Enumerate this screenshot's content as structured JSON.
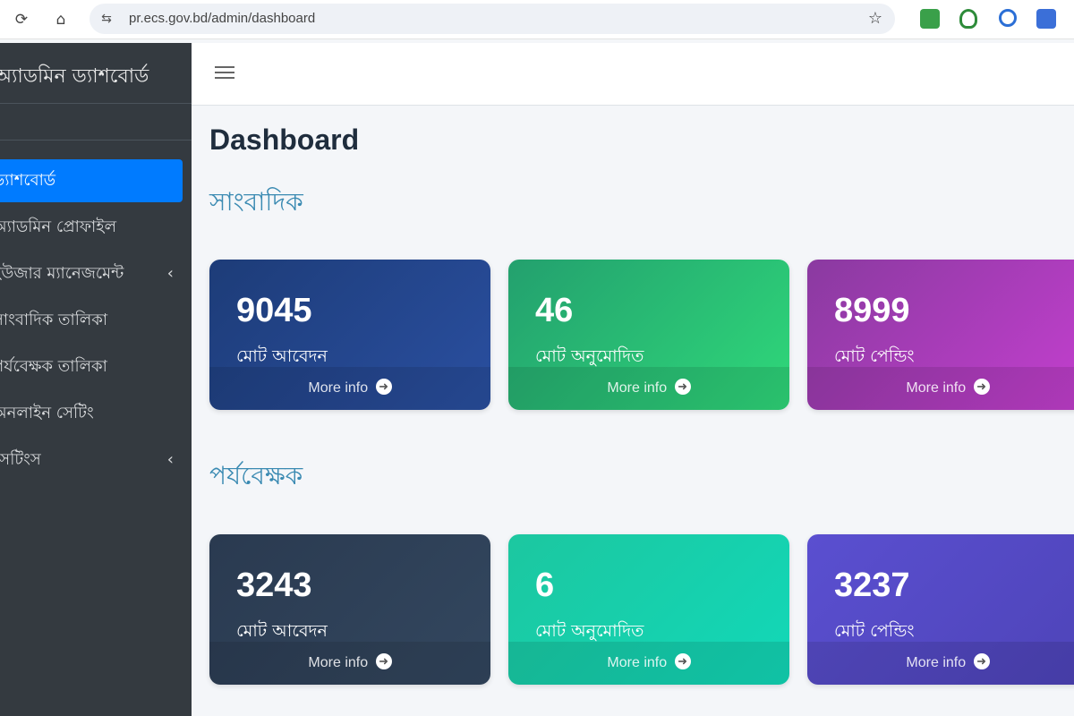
{
  "browser": {
    "url": "pr.ecs.gov.bd/admin/dashboard",
    "reload_icon": "reload-icon",
    "home_icon": "home-icon",
    "site_settings_icon": "tune-icon",
    "bookmark_icon": "star-icon"
  },
  "sidebar": {
    "brand": "অ্যাডমিন ড্যাশবোর্ড",
    "items": [
      {
        "label": "ড্যাশবোর্ড",
        "active": true,
        "has_children": false
      },
      {
        "label": "অ্যাডমিন প্রোফাইল",
        "active": false,
        "has_children": false
      },
      {
        "label": "ইউজার ম্যানেজমেন্ট",
        "active": false,
        "has_children": true
      },
      {
        "label": "সাংবাদিক তালিকা",
        "active": false,
        "has_children": false
      },
      {
        "label": "পর্যবেক্ষক তালিকা",
        "active": false,
        "has_children": false
      },
      {
        "label": "অনলাইন সেটিং",
        "active": false,
        "has_children": false
      },
      {
        "label": "সেটিংস",
        "active": false,
        "has_children": true
      }
    ]
  },
  "header": {
    "menu_icon": "hamburger-icon"
  },
  "main": {
    "title": "Dashboard",
    "sections": [
      {
        "title": "সাংবাদিক",
        "cards": [
          {
            "value": "9045",
            "label": "মোট আবেদন",
            "link": "More info",
            "color": "#1d3c78"
          },
          {
            "value": "46",
            "label": "মোট অনুমোদিত",
            "link": "More info",
            "color": "#23a06e"
          },
          {
            "value": "8999",
            "label": "মোট পেন্ডিং",
            "link": "More info",
            "color": "#8a3aa0"
          }
        ]
      },
      {
        "title": "পর্যবেক্ষক",
        "cards": [
          {
            "value": "3243",
            "label": "মোট আবেদন",
            "link": "More info",
            "color": "#2a3a50"
          },
          {
            "value": "6",
            "label": "মোট অনুমোদিত",
            "link": "More info",
            "color": "#1cc7a0"
          },
          {
            "value": "3237",
            "label": "মোট পেন্ডিং",
            "link": "More info",
            "color": "#5a4fd0"
          }
        ]
      }
    ]
  },
  "colors": {
    "sidebar_bg": "#343a40",
    "active_item": "#007bff",
    "section_title": "#3a8ab2"
  }
}
